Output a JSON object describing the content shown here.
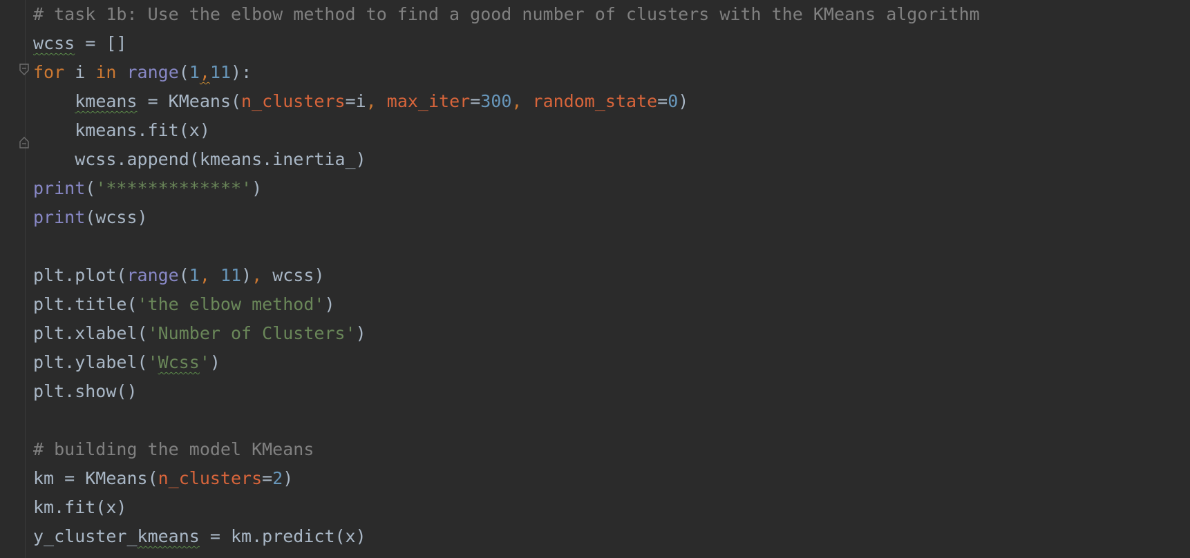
{
  "editor": {
    "lines": [
      {
        "parts": [
          {
            "t": "# task 1b: Use the elbow method to find a good number of clusters with the KMeans algorithm",
            "c": "comment"
          }
        ]
      },
      {
        "parts": [
          {
            "t": "wcss",
            "c": "squig"
          },
          {
            "t": " = []",
            "c": ""
          }
        ]
      },
      {
        "parts": [
          {
            "t": "for",
            "c": "kw"
          },
          {
            "t": " i ",
            "c": ""
          },
          {
            "t": "in",
            "c": "kw"
          },
          {
            "t": " ",
            "c": ""
          },
          {
            "t": "range",
            "c": "builtin"
          },
          {
            "t": "(",
            "c": ""
          },
          {
            "t": "1",
            "c": "num"
          },
          {
            "t": ",",
            "c": "punc warn-squig"
          },
          {
            "t": "11",
            "c": "num"
          },
          {
            "t": "):",
            "c": ""
          }
        ]
      },
      {
        "parts": [
          {
            "t": "    ",
            "c": ""
          },
          {
            "t": "kmeans",
            "c": "squig"
          },
          {
            "t": " = KMeans(",
            "c": ""
          },
          {
            "t": "n_clusters",
            "c": "param2"
          },
          {
            "t": "=i",
            "c": ""
          },
          {
            "t": ", ",
            "c": "punc"
          },
          {
            "t": "max_iter",
            "c": "param2"
          },
          {
            "t": "=",
            "c": ""
          },
          {
            "t": "300",
            "c": "num"
          },
          {
            "t": ", ",
            "c": "punc"
          },
          {
            "t": "random_state",
            "c": "param2"
          },
          {
            "t": "=",
            "c": ""
          },
          {
            "t": "0",
            "c": "num"
          },
          {
            "t": ")",
            "c": ""
          }
        ]
      },
      {
        "parts": [
          {
            "t": "    kmeans.fit(x)",
            "c": ""
          }
        ]
      },
      {
        "parts": [
          {
            "t": "    wcss.append(kmeans.inertia_)",
            "c": ""
          }
        ]
      },
      {
        "parts": [
          {
            "t": "print",
            "c": "builtin"
          },
          {
            "t": "(",
            "c": ""
          },
          {
            "t": "'*************'",
            "c": "str"
          },
          {
            "t": ")",
            "c": ""
          }
        ]
      },
      {
        "parts": [
          {
            "t": "print",
            "c": "builtin"
          },
          {
            "t": "(wcss)",
            "c": ""
          }
        ]
      },
      {
        "parts": [
          {
            "t": "",
            "c": ""
          }
        ]
      },
      {
        "parts": [
          {
            "t": "plt.plot(",
            "c": ""
          },
          {
            "t": "range",
            "c": "builtin"
          },
          {
            "t": "(",
            "c": ""
          },
          {
            "t": "1",
            "c": "num"
          },
          {
            "t": ", ",
            "c": "punc"
          },
          {
            "t": "11",
            "c": "num"
          },
          {
            "t": ")",
            "c": ""
          },
          {
            "t": ", ",
            "c": "punc"
          },
          {
            "t": "wcss)",
            "c": ""
          }
        ]
      },
      {
        "parts": [
          {
            "t": "plt.title(",
            "c": ""
          },
          {
            "t": "'the elbow method'",
            "c": "str"
          },
          {
            "t": ")",
            "c": ""
          }
        ]
      },
      {
        "parts": [
          {
            "t": "plt.xlabel(",
            "c": ""
          },
          {
            "t": "'Number of Clusters'",
            "c": "str"
          },
          {
            "t": ")",
            "c": ""
          }
        ]
      },
      {
        "parts": [
          {
            "t": "plt.ylabel(",
            "c": ""
          },
          {
            "t": "'",
            "c": "str"
          },
          {
            "t": "Wcss",
            "c": "str squig"
          },
          {
            "t": "'",
            "c": "str"
          },
          {
            "t": ")",
            "c": ""
          }
        ]
      },
      {
        "parts": [
          {
            "t": "plt.show()",
            "c": ""
          }
        ]
      },
      {
        "parts": [
          {
            "t": "",
            "c": ""
          }
        ]
      },
      {
        "parts": [
          {
            "t": "# building the model KMeans",
            "c": "comment"
          }
        ]
      },
      {
        "parts": [
          {
            "t": "km = KMeans(",
            "c": ""
          },
          {
            "t": "n_clusters",
            "c": "param2"
          },
          {
            "t": "=",
            "c": ""
          },
          {
            "t": "2",
            "c": "num"
          },
          {
            "t": ")",
            "c": ""
          }
        ]
      },
      {
        "parts": [
          {
            "t": "km.fit(x)",
            "c": ""
          }
        ]
      },
      {
        "parts": [
          {
            "t": "y_cluster_",
            "c": ""
          },
          {
            "t": "kmeans",
            "c": "squig"
          },
          {
            "t": " = km.predict(x)",
            "c": ""
          }
        ]
      }
    ]
  }
}
